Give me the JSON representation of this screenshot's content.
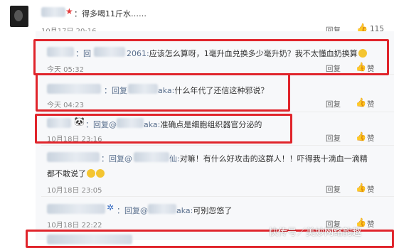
{
  "top_comment": {
    "text": "：得多喝11斤水……",
    "time": "10月17日 20:16",
    "reply_label": "回复",
    "like_count": "115"
  },
  "replies": [
    {
      "prefix": "：回",
      "mid": "2061:",
      "text": "应该怎么算呀，1毫升血兑换多少毫升奶？我不太懂血奶换算",
      "time": "今天 05:32",
      "reply_label": "回复",
      "like_label": "赞"
    },
    {
      "prefix": "：回复",
      "mid": "aka:",
      "text": "什么年代了还信这种邪说？",
      "time": "今天 04:23",
      "reply_label": "回复",
      "like_label": "赞"
    },
    {
      "prefix": "：回复@",
      "mid": "aka:",
      "text": "准确点是细胞组织器官分泌的",
      "time": "10月18日 23:16",
      "reply_label": "回复",
      "like_label": "赞"
    },
    {
      "prefix": "：回复@",
      "mid": "仙:",
      "text": "对嘛！有什么好攻击的这群人！！吓得我十滴血一滴精",
      "text2": "都不敢说了",
      "time": "10月18日 23:05",
      "reply_label": "回复",
      "like_label": "赞"
    },
    {
      "prefix": "：回复@",
      "mid": "aka:",
      "text": "可别忽悠了",
      "time": "10月18日 22:22",
      "reply_label": "回复",
      "like_label": "赞"
    }
  ],
  "watermark": "快传号／美妙网络韵趣",
  "colors": {
    "highlight_border": "#e0242b",
    "username": "#596f8d"
  }
}
